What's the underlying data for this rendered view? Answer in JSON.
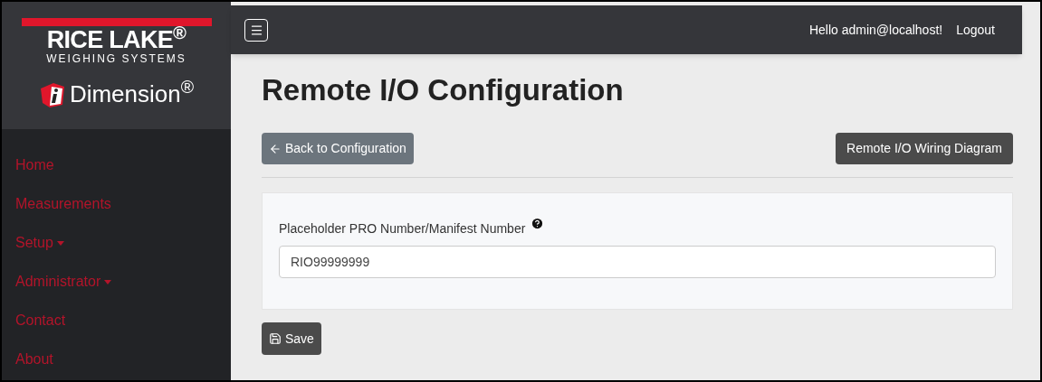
{
  "logo": {
    "brand": "RICE LAKE$^{®}$",
    "tagline": "WEIGHING SYSTEMS",
    "product": "Dimension$^{®}$"
  },
  "sidebar": {
    "items": [
      {
        "label": "Home",
        "kind": "link"
      },
      {
        "label": "Measurements",
        "kind": "link"
      },
      {
        "label": "Setup",
        "kind": "dropdown"
      },
      {
        "label": "Administrator",
        "kind": "dropdown"
      },
      {
        "label": "Contact",
        "kind": "link"
      },
      {
        "label": "About",
        "kind": "link"
      }
    ]
  },
  "navbar": {
    "greeting": "Hello admin@localhost!",
    "logout": "Logout"
  },
  "page": {
    "title": "Remote I/O Configuration",
    "back_button": "Back to Configuration",
    "diagram_button": "Remote I/O Wiring Diagram",
    "field": {
      "label": "Placeholder PRO Number/Manifest Number",
      "value": "RIO99999999"
    },
    "save_button": "Save"
  }
}
